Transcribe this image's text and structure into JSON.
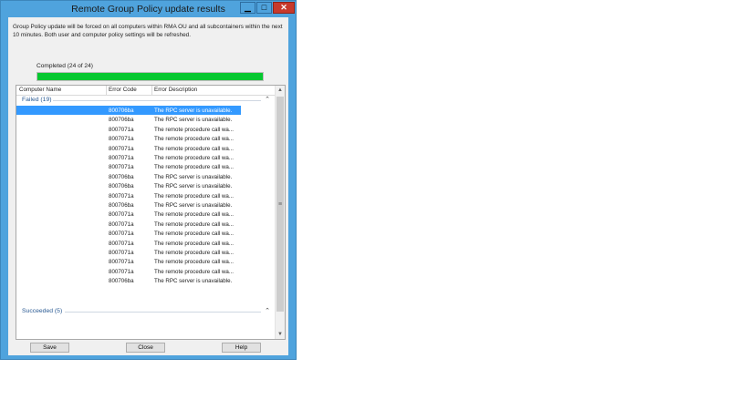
{
  "window": {
    "title": "Remote Group Policy update results"
  },
  "titlebar": {
    "minimize_glyph": "▁",
    "maximize_glyph": "□",
    "close_glyph": "✕"
  },
  "info_text": "Group Policy update will be forced on all computers within RMA OU and all subcontainers within the next 10 minutes. Both user and computer policy settings will be refreshed.",
  "progress": {
    "label": "Completed (24 of 24)",
    "fraction": 1.0,
    "color": "#06c830"
  },
  "columns": {
    "name": "Computer Name",
    "code": "Error Code",
    "desc": "Error Description"
  },
  "groups": {
    "failed": {
      "label": "Failed (19)"
    },
    "succeeded": {
      "label": "Succeeded (5)"
    }
  },
  "failed_rows": [
    {
      "code": "800706ba",
      "desc": "The RPC server is unavailable.",
      "selected": true
    },
    {
      "code": "800706ba",
      "desc": "The RPC server is unavailable."
    },
    {
      "code": "8007071a",
      "desc": "The remote procedure call wa..."
    },
    {
      "code": "8007071a",
      "desc": "The remote procedure call wa..."
    },
    {
      "code": "8007071a",
      "desc": "The remote procedure call wa..."
    },
    {
      "code": "8007071a",
      "desc": "The remote procedure call wa..."
    },
    {
      "code": "8007071a",
      "desc": "The remote procedure call wa..."
    },
    {
      "code": "800706ba",
      "desc": "The RPC server is unavailable."
    },
    {
      "code": "800706ba",
      "desc": "The RPC server is unavailable."
    },
    {
      "code": "8007071a",
      "desc": "The remote procedure call wa..."
    },
    {
      "code": "800706ba",
      "desc": "The RPC server is unavailable."
    },
    {
      "code": "8007071a",
      "desc": "The remote procedure call wa..."
    },
    {
      "code": "8007071a",
      "desc": "The remote procedure call wa..."
    },
    {
      "code": "8007071a",
      "desc": "The remote procedure call wa..."
    },
    {
      "code": "8007071a",
      "desc": "The remote procedure call wa..."
    },
    {
      "code": "8007071a",
      "desc": "The remote procedure call wa..."
    },
    {
      "code": "8007071a",
      "desc": "The remote procedure call wa..."
    },
    {
      "code": "8007071a",
      "desc": "The remote procedure call wa..."
    },
    {
      "code": "800706ba",
      "desc": "The RPC server is unavailable."
    }
  ],
  "succeeded_rows": [
    {},
    {},
    {},
    {},
    {}
  ],
  "buttons": {
    "save": "Save",
    "close": "Close",
    "help": "Help"
  },
  "icons": {
    "group_collapse": "chevron-up-icon",
    "scroll_up": "arrow-up-icon",
    "scroll_down": "arrow-down-icon",
    "scroll_grip": "grip-icon"
  },
  "colors": {
    "title_bar": "#4fa3dd",
    "selection": "#3399ff",
    "close_button": "#c7392c"
  }
}
